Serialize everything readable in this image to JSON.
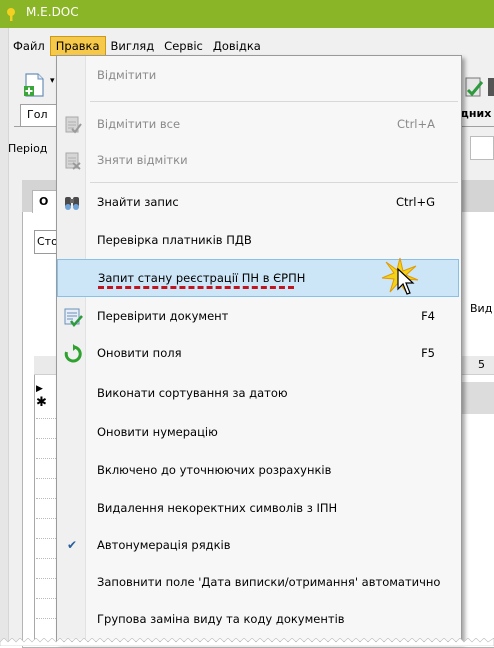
{
  "window": {
    "title": "M.E.DOC"
  },
  "menubar": {
    "items": [
      {
        "label": "Файл"
      },
      {
        "label": "Правка"
      },
      {
        "label": "Вигляд"
      },
      {
        "label": "Сервіс"
      },
      {
        "label": "Довідка"
      }
    ],
    "active_index": 1
  },
  "tabs": {
    "first": "Гол",
    "second": "дних"
  },
  "period": {
    "label": "Період"
  },
  "panel": {
    "tab_label": "О",
    "combo_value": "Сто",
    "column_vid": "Вид",
    "number_cell": "5"
  },
  "menu": {
    "items": [
      {
        "label": "Відмітити",
        "shortcut": "",
        "disabled": true,
        "icon": ""
      },
      {
        "label": "Відмітити все",
        "shortcut": "Ctrl+A",
        "disabled": true,
        "icon": "check-all-icon"
      },
      {
        "label": "Зняти відмітки",
        "shortcut": "",
        "disabled": true,
        "icon": "uncheck-icon"
      },
      {
        "label": "Знайти запис",
        "shortcut": "Ctrl+G",
        "disabled": false,
        "icon": "binoculars-icon"
      },
      {
        "label": "Перевірка платників ПДВ",
        "shortcut": "",
        "disabled": false,
        "icon": ""
      },
      {
        "label": "Запит стану реєстрації ПН в ЄРПН",
        "shortcut": "",
        "disabled": false,
        "icon": "",
        "highlighted": true
      },
      {
        "label": "Перевірити документ",
        "shortcut": "F4",
        "disabled": false,
        "icon": "check-document-icon"
      },
      {
        "label": "Оновити поля",
        "shortcut": "F5",
        "disabled": false,
        "icon": "refresh-icon"
      },
      {
        "label": "Виконати сортування за датою",
        "shortcut": "",
        "disabled": false,
        "icon": ""
      },
      {
        "label": "Оновити нумерацію",
        "shortcut": "",
        "disabled": false,
        "icon": ""
      },
      {
        "label": "Включено до уточнюючих розрахунків",
        "shortcut": "",
        "disabled": false,
        "icon": ""
      },
      {
        "label": "Видалення некоректних символів з ІПН",
        "shortcut": "",
        "disabled": false,
        "icon": ""
      },
      {
        "label": "Автонумерація рядків",
        "shortcut": "",
        "disabled": false,
        "icon": "checkmark-icon",
        "checked": true
      },
      {
        "label": "Заповнити поле 'Дата виписки/отримання' автоматично",
        "shortcut": "",
        "disabled": false,
        "icon": ""
      },
      {
        "label": "Групова заміна виду та коду документів",
        "shortcut": "",
        "disabled": false,
        "icon": ""
      }
    ]
  },
  "colors": {
    "titlebar": "#8ab527",
    "menu_active": "#f7c94a",
    "highlight": "#cde6f7",
    "underline": "#c0141f"
  }
}
